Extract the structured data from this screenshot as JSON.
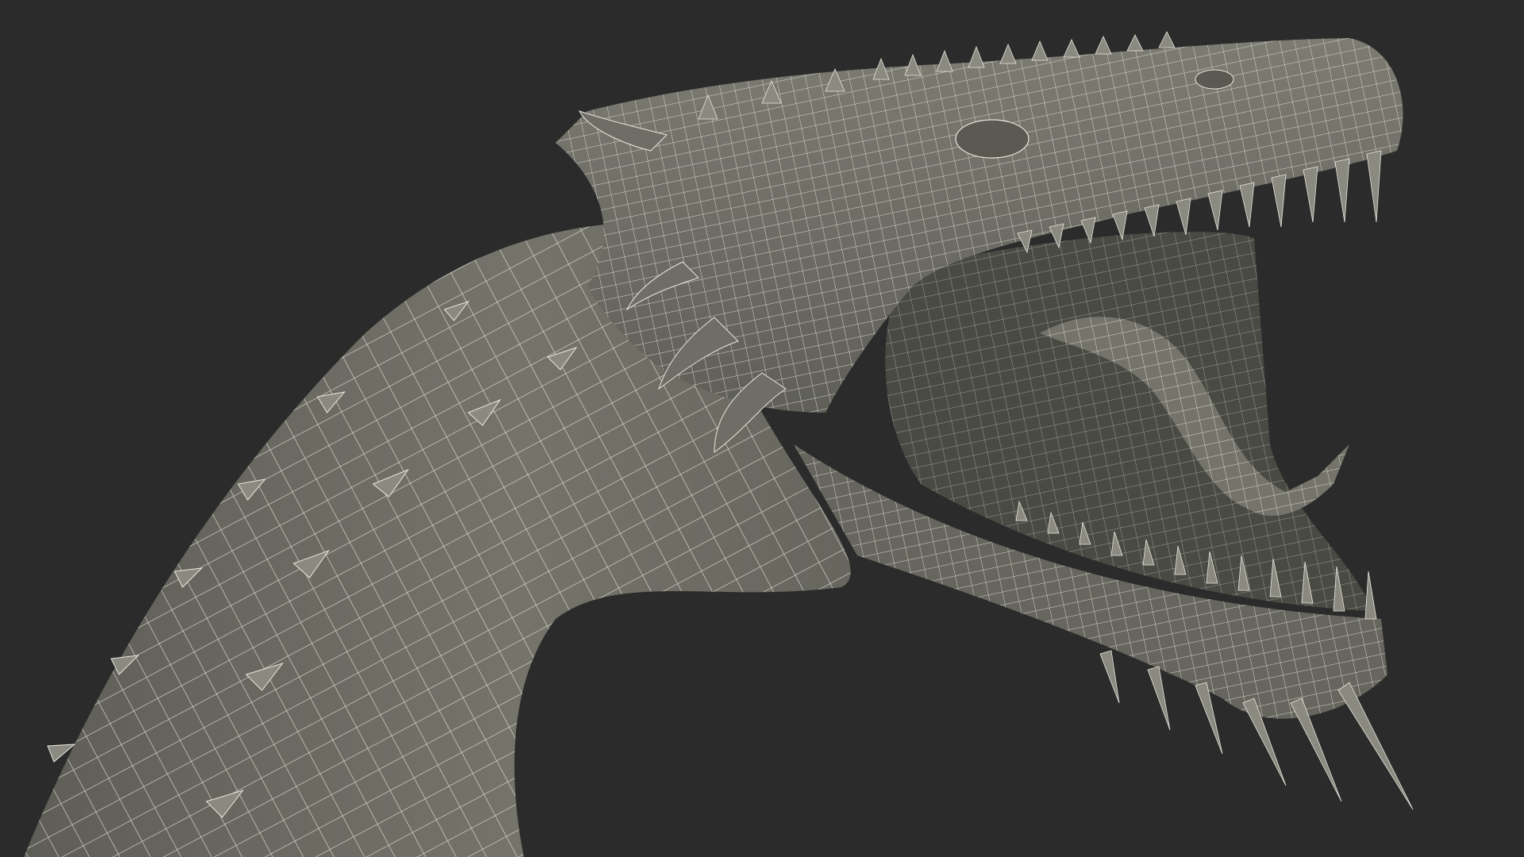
{
  "scene": {
    "subject": "dragon-head-wireframe-render",
    "background_color": "#2b2b2b",
    "mesh_fill_color": "#6b6b63",
    "mesh_shadow_color": "#55554e",
    "mesh_highlight_color": "#7c7c73",
    "wire_color": "#e8e8e0",
    "mouth_interior_color": "#4a4a44",
    "spike_color": "#8a8a80"
  }
}
